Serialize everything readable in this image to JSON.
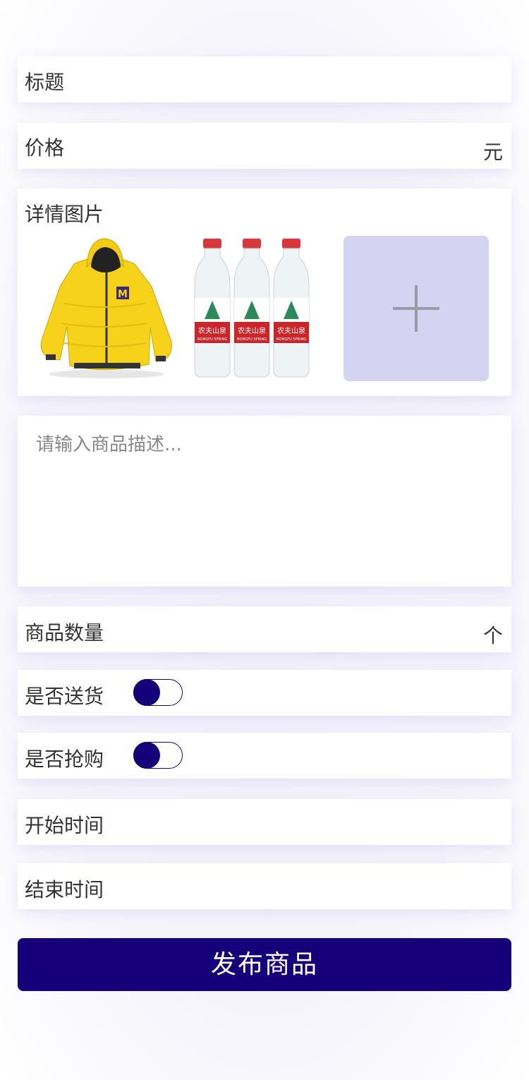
{
  "form": {
    "title_label": "标题",
    "price_label": "价格",
    "price_unit": "元",
    "images_label": "详情图片",
    "description_placeholder": "请输入商品描述...",
    "quantity_label": "商品数量",
    "quantity_unit": "个",
    "delivery_label": "是否送货",
    "delivery_on": true,
    "flash_sale_label": "是否抢购",
    "flash_sale_on": true,
    "start_time_label": "开始时间",
    "end_time_label": "结束时间"
  },
  "images": [
    {
      "name": "yellow-jacket-image"
    },
    {
      "name": "water-bottles-image",
      "bottle_text": "农夫山泉",
      "bottle_subtext": "NONGFU SPRING"
    }
  ],
  "actions": {
    "publish_label": "发布商品"
  },
  "colors": {
    "accent": "#16007a",
    "add_tile": "#d4d3f1",
    "jacket_yellow": "#f6d21a",
    "bottle_label_red": "#c8262b"
  }
}
